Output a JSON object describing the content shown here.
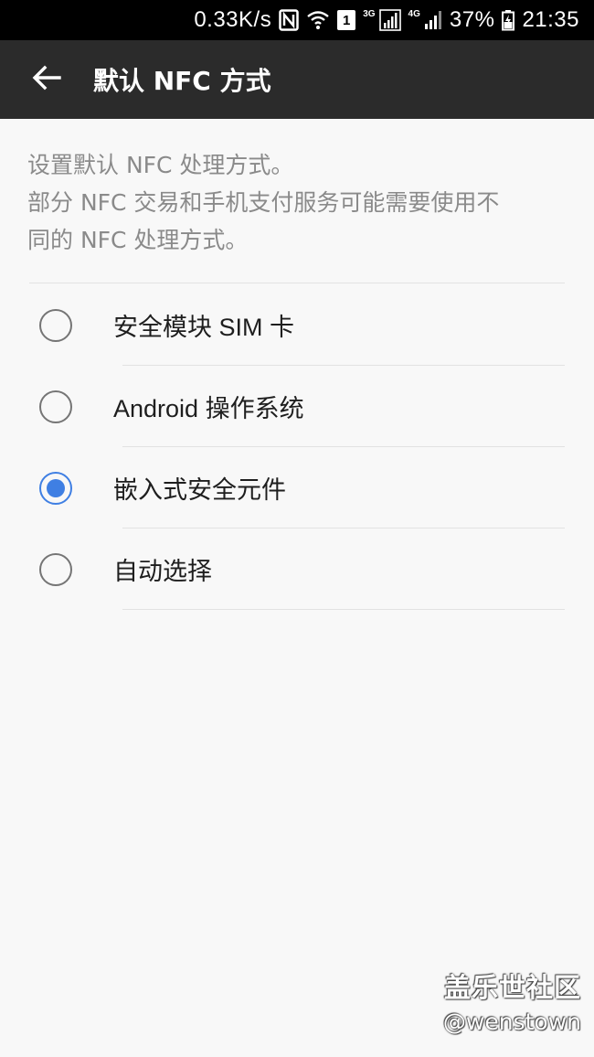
{
  "status_bar": {
    "net_speed": "0.33K/s",
    "nfc_icon": "nfc-icon",
    "wifi_icon": "wifi-icon",
    "sim_slot": "1",
    "network_3g": "3G",
    "network_4g": "4G",
    "battery_percent": "37%",
    "time": "21:35"
  },
  "app_bar": {
    "back_icon": "arrow-left-icon",
    "title": "默认 NFC 方式"
  },
  "description": {
    "line1": "设置默认 NFC 处理方式。",
    "line2": "部分 NFC 交易和手机支付服务可能需要使用不",
    "line3": "同的 NFC 处理方式。"
  },
  "options": [
    {
      "label": "安全模块 SIM 卡",
      "selected": false
    },
    {
      "label": "Android 操作系统",
      "selected": false
    },
    {
      "label": "嵌入式安全元件",
      "selected": true
    },
    {
      "label": "自动选择",
      "selected": false
    }
  ],
  "colors": {
    "accent": "#3f7fe3",
    "app_bar": "#2b2b2b",
    "background": "#f8f8f8"
  },
  "watermark": {
    "title": "盖乐世社区",
    "handle": "@wenstown"
  }
}
